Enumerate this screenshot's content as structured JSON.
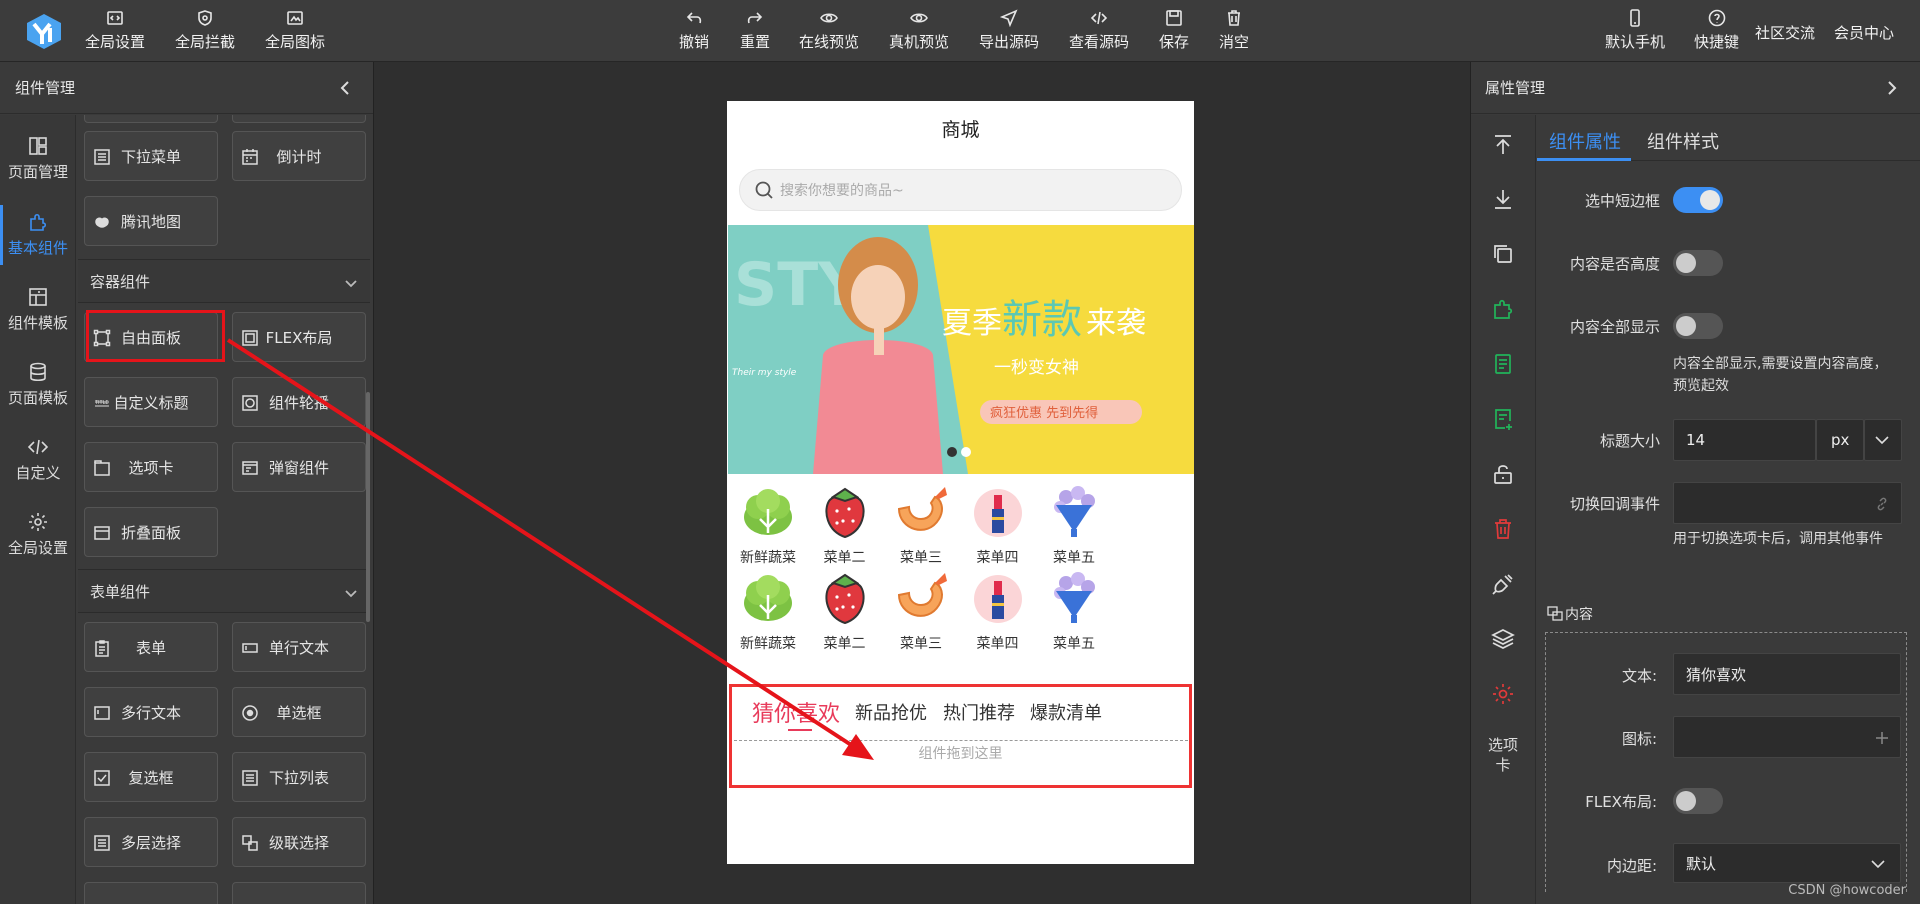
{
  "toolbar": {
    "left": [
      "全局设置",
      "全局拦截",
      "全局图标"
    ],
    "center": [
      "撤销",
      "重置",
      "在线预览",
      "真机预览",
      "导出源码",
      "查看源码",
      "保存",
      "消空"
    ],
    "right": [
      "默认手机",
      "快捷键",
      "社区交流",
      "会员中心"
    ]
  },
  "left_panel": {
    "title": "组件管理",
    "nav": [
      "页面管理",
      "基本组件",
      "组件模板",
      "页面模板",
      "自定义",
      "全局设置"
    ],
    "components_top": [
      "下拉菜单",
      "倒计时",
      "腾讯地图"
    ],
    "container_section": "容器组件",
    "container_items": [
      "自由面板",
      "FLEX布局",
      "自定义标题",
      "组件轮播",
      "选项卡",
      "弹窗组件",
      "折叠面板"
    ],
    "form_section": "表单组件",
    "form_items": [
      "表单",
      "单行文本",
      "多行文本",
      "单选框",
      "复选框",
      "下拉列表",
      "多层选择",
      "级联选择"
    ]
  },
  "phone": {
    "title": "商城",
    "search_placeholder": "搜索你想要的商品~",
    "banner": {
      "headline_1": "夏季",
      "headline_2": "新款",
      "headline_3": "来袭",
      "sub": "一秒变女神",
      "promo": "疯狂优惠 先到先得",
      "left_text": "STY",
      "tag": "Their my style"
    },
    "menu_row1": [
      "新鲜蔬菜",
      "菜单二",
      "菜单三",
      "菜单四",
      "菜单五"
    ],
    "menu_row2": [
      "新鲜蔬菜",
      "菜单二",
      "菜单三",
      "菜单四",
      "菜单五"
    ],
    "tabs": [
      "猜你喜欢",
      "新品抢优",
      "热门推荐",
      "爆款清单"
    ],
    "drop_hint": "组件拖到这里"
  },
  "right_panel": {
    "title": "属性管理",
    "tabs": [
      "组件属性",
      "组件样式"
    ],
    "tool_label": "选项卡",
    "props": {
      "border_label": "选中短边框",
      "height_label": "内容是否高度",
      "showall_label": "内容全部显示",
      "showall_hint": "内容全部显示,需要设置内容高度，预览起效",
      "title_size_label": "标题大小",
      "title_size_value": "14",
      "title_size_unit": "px",
      "callback_label": "切换回调事件",
      "callback_hint": "用于切换选项卡后，调用其他事件",
      "content_section": "内容",
      "text_label": "文本:",
      "text_value": "猜你喜欢",
      "icon_label": "图标:",
      "flex_label": "FLEX布局:",
      "padding_label": "内边距:",
      "padding_value": "默认"
    },
    "toggles": {
      "border": true,
      "height": false,
      "showall": false,
      "flex": false
    }
  },
  "watermark": "CSDN @howcoder",
  "colors": {
    "accent": "#3c8ff3",
    "tab_active": "#e83a5a",
    "highlight": "#e5141a"
  }
}
